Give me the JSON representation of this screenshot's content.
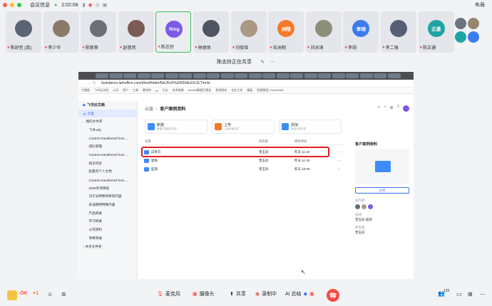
{
  "topbar": {
    "meeting_info": "会议信息",
    "time": "2:02:08",
    "layout_label": "布局"
  },
  "participants": [
    {
      "name": "陈舒哲 (我)",
      "avatar_color": "#5a6473",
      "avatar_text": ""
    },
    {
      "name": "李少华",
      "avatar_color": "#8a7a6a",
      "avatar_text": ""
    },
    {
      "name": "陈新移",
      "avatar_color": "#6b6f78",
      "avatar_text": ""
    },
    {
      "name": "赵悠然",
      "avatar_color": "#7c5a54",
      "avatar_text": ""
    },
    {
      "name": "陈志铃",
      "avatar_color": "#7c59e6",
      "avatar_text": "Ring"
    },
    {
      "name": "林丽贤",
      "avatar_color": "#4f5560",
      "avatar_text": ""
    },
    {
      "name": "刘俊铭",
      "avatar_color": "#a99883",
      "avatar_text": ""
    },
    {
      "name": "伍洲翔",
      "avatar_color": "#f5792a",
      "avatar_text": "洲翔"
    },
    {
      "name": "刘冰涛",
      "avatar_color": "#8d8f78",
      "avatar_text": ""
    },
    {
      "name": "李翊",
      "avatar_color": "#3c7cf0",
      "avatar_text": "李翊"
    },
    {
      "name": "李二强",
      "avatar_color": "#566075",
      "avatar_text": ""
    },
    {
      "name": "陈正通",
      "avatar_color": "#1ea5a3",
      "avatar_text": "正通"
    }
  ],
  "share_banner": "陈志铃正在共享",
  "browser": {
    "url": "bytedance.larkoffice.com/drive/folder/NeUfcdYlaZWDdlu2Xc2LTmnIe",
    "bookmarks": [
      "大数据",
      "飞书云文档",
      "公司",
      "用户",
      "工具",
      "素材库",
      "Ai",
      "行业",
      "技术前端",
      "AesGA数据可视化",
      "常用网站",
      "论文工作",
      "模板",
      "短视频组 | HanoSMS"
    ]
  },
  "sidebar": {
    "header": "飞书云文档",
    "cloud": "云盘",
    "items": [
      "我的文件夹",
      "飞书.ally",
      "Content transferred from ...",
      "团队管理",
      "Content transferred from ...",
      "知识问答",
      "赵夏的个人文档",
      "Content transferred from ...",
      "2025年项目组",
      "对于光特殊项目的内容",
      "未读模特特殊内容",
      "产品目录",
      "学习目录",
      "公司资料",
      "项目目录"
    ],
    "shared": "共享文件夹"
  },
  "main": {
    "breadcrumb_root": "云盘",
    "breadcrumb_current": "客户案例资料",
    "cards": [
      {
        "title": "新建",
        "sub": "新建文档和文件夹",
        "color": "#3c8cfb"
      },
      {
        "title": "上传",
        "sub": "上传本地文件",
        "color": "#f5792a"
      },
      {
        "title": "添加",
        "sub": "添加已有文件",
        "color": "#3c8cfb"
      }
    ],
    "columns": {
      "name": "名称",
      "owner": "所有者",
      "modified": "修改时间"
    },
    "rows": [
      {
        "name": "白骨方",
        "owner": "曾玉凤",
        "modified": "昨天 11:19"
      },
      {
        "name": "星啦",
        "owner": "曾玉凤",
        "modified": "昨天 11:19"
      },
      {
        "name": "蓝鹊",
        "owner": "曾玉凤",
        "modified": "昨天 22:00"
      }
    ],
    "detail": {
      "title": "客户案例资料",
      "share": "分享",
      "collab_label": "协作者",
      "desc_label": "描述",
      "desc": "曾玉凤 描述",
      "owner_label": "所有者",
      "owner": "曾玉凤"
    }
  },
  "bottombar": {
    "mic": "麦克风",
    "camera": "摄像头",
    "share": "共享",
    "record": "录制中",
    "ai_summary": "AI 总结",
    "participants_count": "125",
    "emoji_ok": "OK",
    "emoji_plus": "+1"
  },
  "colors": {
    "accent": "#3ec15b",
    "danger": "#f54a45",
    "highlight": "#e02020",
    "primary": "#3370ff"
  }
}
